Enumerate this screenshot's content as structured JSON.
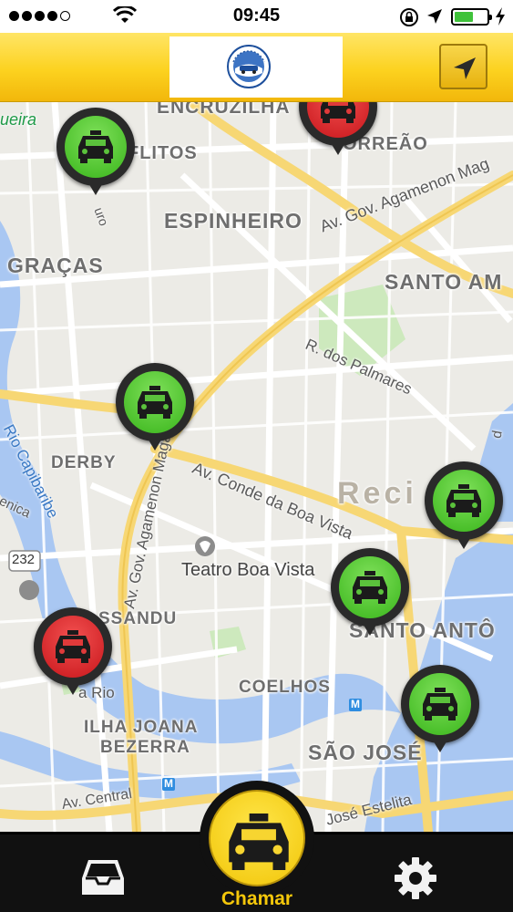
{
  "status_bar": {
    "time": "09:45",
    "signal_bars": 4,
    "battery_level": 0.55,
    "icons": [
      "signal-dots-icon",
      "wifi-icon",
      "rotation-lock-icon",
      "location-arrow-icon",
      "battery-icon",
      "charging-bolt-icon"
    ]
  },
  "header": {
    "logo_icon": "company-emblem-icon",
    "locate_button_icon": "location-arrow-icon",
    "accent_color": "#fcd21f"
  },
  "map": {
    "neighborhoods": {
      "encruzilhada": "ENCRUZILHA",
      "aflitos": "FLITOS",
      "torreao": "ORREÃO",
      "espinheiro": "ESPINHEIRO",
      "gracas": "GRAÇAS",
      "santo_amaro": "SANTO AM",
      "derby": "DERBY",
      "recife": "Reci",
      "paissandu": "SSANDU",
      "santo_antonio": "SANTO ANTÔ",
      "coelhos": "COELHOS",
      "ilha_joana_bezerra_1": "ILHA JOANA",
      "ilha_joana_bezerra_2": "BEZERRA",
      "sao_jose": "SÃO JOSÉ"
    },
    "streets": {
      "agamenon_top": "Av. Gov. Agamenon Mag",
      "agamenon_vertical": "Av. Gov. Agamenon Magalhães",
      "palmares": "R. dos Palmares",
      "boa_vista": "Av. Conde da Boa Vista",
      "central": "Av. Central",
      "estelita": "José Estelita",
      "ro_label": "uro",
      "rio_label": "a Rio",
      "queira": "ueira",
      "enica": "enica",
      "edge_d": "d"
    },
    "rivers": {
      "capibaribe": "Rio Capibaribe"
    },
    "poi": {
      "teatro": "Teatro Boa Vista",
      "route_shield": "232",
      "metro_symbol": "M"
    },
    "taxis": [
      {
        "status": "free"
      },
      {
        "status": "busy"
      },
      {
        "status": "free"
      },
      {
        "status": "free"
      },
      {
        "status": "free"
      },
      {
        "status": "busy"
      },
      {
        "status": "free"
      }
    ],
    "colors": {
      "free": "#39b51b",
      "busy": "#c8161b"
    }
  },
  "tab_bar": {
    "inbox_icon": "inbox-tray-icon",
    "call_label": "Chamar",
    "call_icon": "taxi-icon",
    "settings_icon": "gear-icon"
  }
}
